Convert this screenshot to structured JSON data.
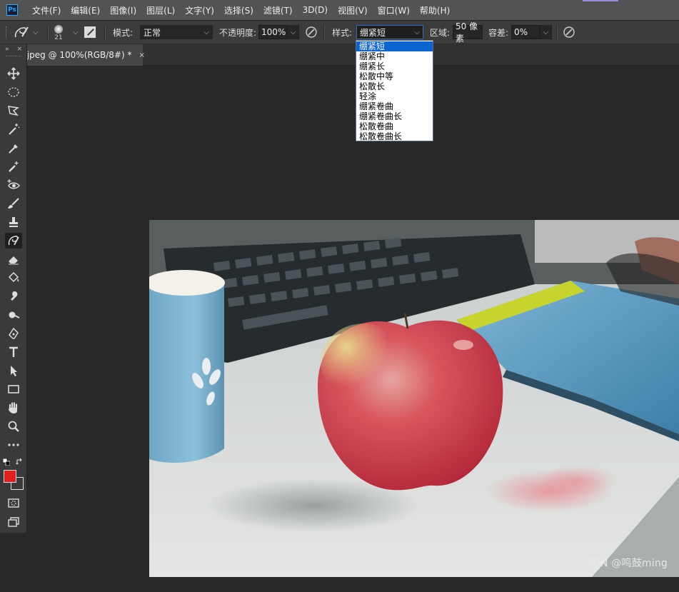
{
  "app": {
    "logo_text": "Ps"
  },
  "menubar": {
    "items": [
      "文件(F)",
      "编辑(E)",
      "图像(I)",
      "图层(L)",
      "文字(Y)",
      "选择(S)",
      "滤镜(T)",
      "3D(D)",
      "视图(V)",
      "窗口(W)",
      "帮助(H)"
    ]
  },
  "options": {
    "brush_size": "21",
    "mode_label": "模式:",
    "mode_value": "正常",
    "opacity_label": "不透明度:",
    "opacity_value": "100%",
    "style_label": "样式:",
    "style_value": "绷紧短",
    "area_label": "区域:",
    "area_value": "50 像素",
    "tolerance_label": "容差:",
    "tolerance_value": "0%"
  },
  "style_dropdown": {
    "options": [
      "绷紧短",
      "绷紧中",
      "绷紧长",
      "松散中等",
      "松散长",
      "轻涂",
      "绷紧卷曲",
      "绷紧卷曲长",
      "松散卷曲",
      "松散卷曲长"
    ],
    "selected_index": 0
  },
  "document_tab": {
    "title": ".jpeg @ 100%(RGB/8#) *",
    "close": "×"
  },
  "toolbar": {
    "collapse_label": "»",
    "close_label": "×",
    "tools": [
      "move-tool",
      "elliptical-marquee-tool",
      "polygonal-lasso-tool",
      "magic-wand-tool",
      "eyedropper-tool",
      "spot-healing-brush-tool",
      "red-eye-tool",
      "brush-tool",
      "clone-stamp-tool",
      "art-history-brush-tool",
      "eraser-tool",
      "paint-bucket-tool",
      "smudge-tool",
      "dodge-tool",
      "pen-tool",
      "type-tool",
      "path-selection-tool",
      "rectangle-tool",
      "hand-tool",
      "zoom-tool",
      "more-tools"
    ],
    "active_tool": "art-history-brush-tool",
    "foreground_color": "#e02020",
    "background_color": "#3a3a3a"
  },
  "watermark": "CSDN @鸣鼓ming"
}
